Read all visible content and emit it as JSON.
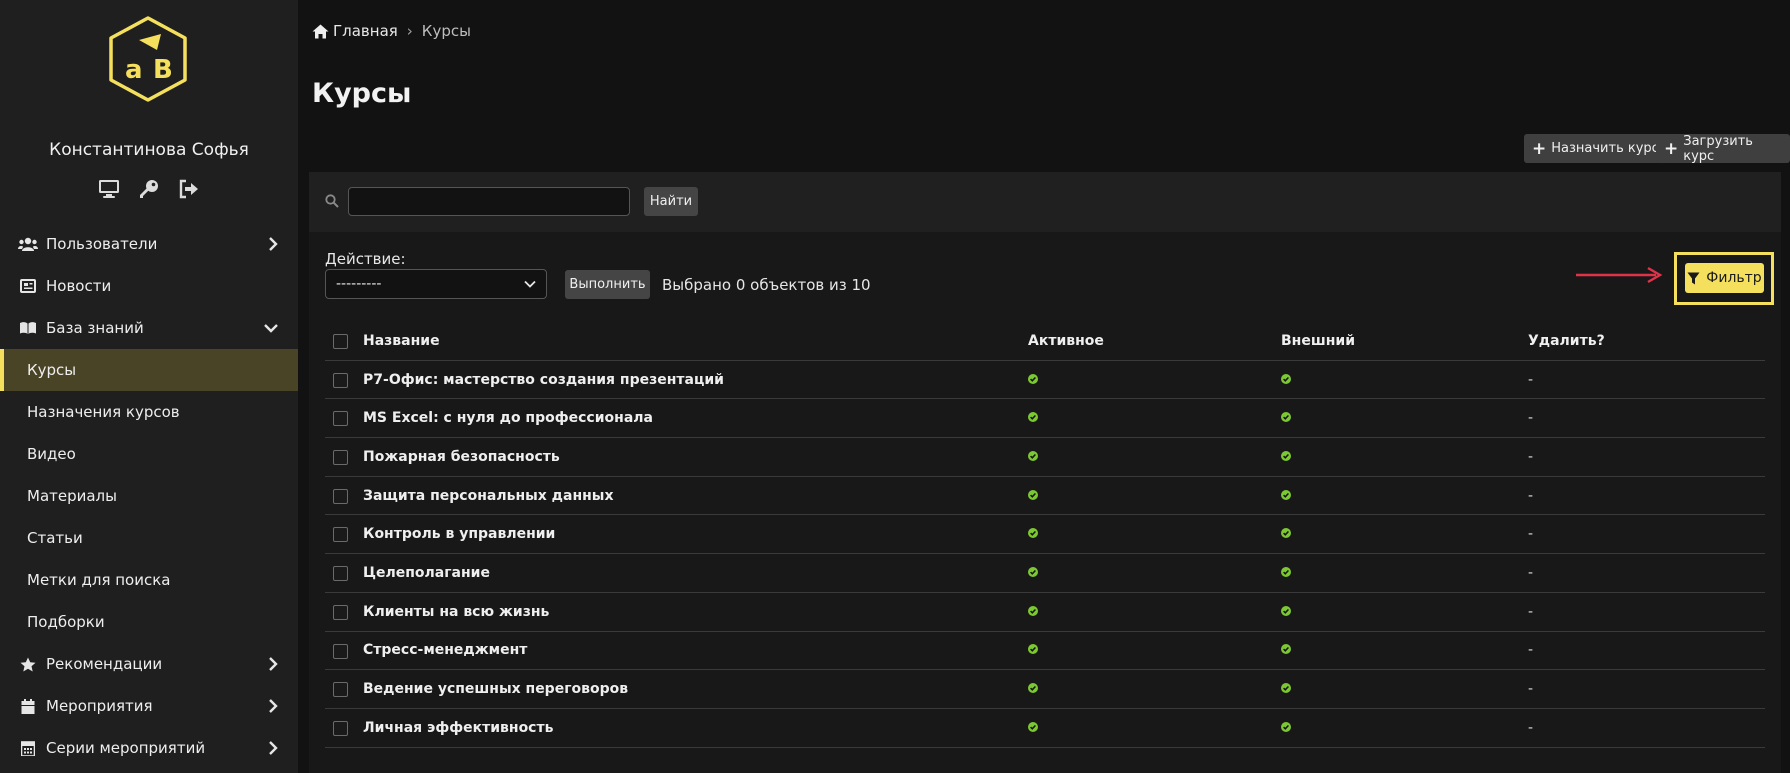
{
  "sidebar": {
    "user_name": "Константинова Софья",
    "user_actions": [
      "monitor-icon",
      "key-icon",
      "logout-icon"
    ],
    "items": [
      {
        "label": "Пользователи",
        "icon": "users-icon",
        "chevron": "right"
      },
      {
        "label": "Новости",
        "icon": "newspaper-icon"
      },
      {
        "label": "База знаний",
        "icon": "book-icon",
        "chevron": "down"
      },
      {
        "label": "Курсы",
        "active": true,
        "sub": true
      },
      {
        "label": "Назначения курсов",
        "sub": true
      },
      {
        "label": "Видео",
        "sub": true
      },
      {
        "label": "Материалы",
        "sub": true
      },
      {
        "label": "Статьи",
        "sub": true
      },
      {
        "label": "Метки для поиска",
        "sub": true
      },
      {
        "label": "Подборки",
        "sub": true
      },
      {
        "label": "Рекомендации",
        "icon": "star-icon",
        "chevron": "right"
      },
      {
        "label": "Мероприятия",
        "icon": "calendar-icon",
        "chevron": "right"
      },
      {
        "label": "Серии мероприятий",
        "icon": "calendar-grid-icon",
        "chevron": "right"
      }
    ]
  },
  "breadcrumb": {
    "home": "Главная",
    "separator": "›",
    "current": "Курсы"
  },
  "page_title": "Курсы",
  "toolbar": {
    "assign_label": "Назначить курс",
    "upload_label": "Загрузить курс"
  },
  "search": {
    "value": "",
    "button_label": "Найти"
  },
  "actions": {
    "label": "Действие:",
    "selected": "---------",
    "run_label": "Выполнить",
    "counter": "Выбрано 0 объектов из 10"
  },
  "filter": {
    "label": "Фильтр"
  },
  "table": {
    "columns": [
      "Название",
      "Активное",
      "Внешний",
      "Удалить?"
    ],
    "rows": [
      {
        "name": "Р7-Офис: мастерство создания презентаций",
        "active": true,
        "external": true,
        "delete": "-"
      },
      {
        "name": "MS Excel: с нуля до профессионала",
        "active": true,
        "external": true,
        "delete": "-"
      },
      {
        "name": "Пожарная безопасность",
        "active": true,
        "external": true,
        "delete": "-"
      },
      {
        "name": "Защита персональных данных",
        "active": true,
        "external": true,
        "delete": "-"
      },
      {
        "name": "Контроль в управлении",
        "active": true,
        "external": true,
        "delete": "-"
      },
      {
        "name": "Целеполагание",
        "active": true,
        "external": true,
        "delete": "-"
      },
      {
        "name": "Клиенты на всю жизнь",
        "active": true,
        "external": true,
        "delete": "-"
      },
      {
        "name": "Стресс-менеджмент",
        "active": true,
        "external": true,
        "delete": "-"
      },
      {
        "name": "Ведение успешных переговоров",
        "active": true,
        "external": true,
        "delete": "-"
      },
      {
        "name": "Личная эффективность",
        "active": true,
        "external": true,
        "delete": "-"
      }
    ]
  },
  "colors": {
    "accent": "#f5e05e",
    "check": "#7cc832",
    "annotation_arrow": "#e0334a"
  }
}
